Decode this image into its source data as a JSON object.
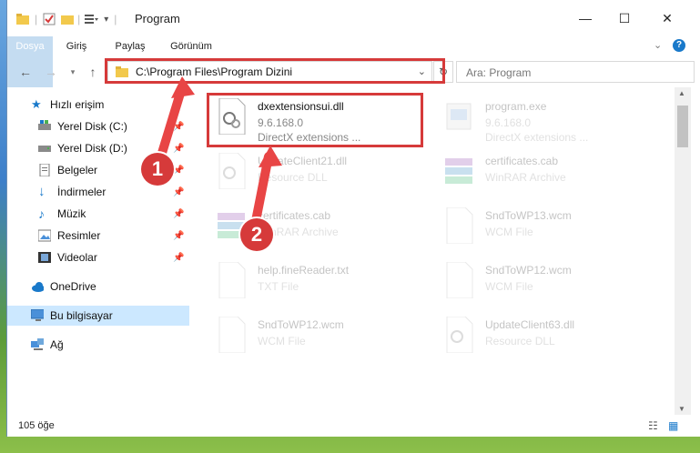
{
  "window": {
    "title": "Program"
  },
  "ribbon": {
    "tabs": [
      "Dosya",
      "Giriş",
      "Paylaş",
      "Görünüm"
    ]
  },
  "address": {
    "path": "C:\\Program Files\\Program Dizini"
  },
  "search": {
    "placeholder": "Ara: Program"
  },
  "sidebar": {
    "items": [
      {
        "label": "Hızlı erişim",
        "icon": "star-icon"
      },
      {
        "label": "Yerel Disk (C:)",
        "icon": "drive-icon"
      },
      {
        "label": "Yerel Disk (D:)",
        "icon": "drive-icon"
      },
      {
        "label": "Belgeler",
        "icon": "documents-icon"
      },
      {
        "label": "İndirmeler",
        "icon": "download-icon"
      },
      {
        "label": "Müzik",
        "icon": "music-icon"
      },
      {
        "label": "Resimler",
        "icon": "pictures-icon"
      },
      {
        "label": "Videolar",
        "icon": "videos-icon"
      },
      {
        "label": "OneDrive",
        "icon": "cloud-icon"
      },
      {
        "label": "Bu bilgisayar",
        "icon": "computer-icon"
      },
      {
        "label": "Ağ",
        "icon": "network-icon"
      }
    ]
  },
  "files": [
    {
      "name": "dxextensionsui.dll",
      "s1": "9.6.168.0",
      "s2": "DirectX extensions ..."
    },
    {
      "name": "program.exe",
      "s1": "9.6.168.0",
      "s2": "DirectX extensions ..."
    },
    {
      "name": "UpdateClient21.dll",
      "s1": "Resource DLL",
      "s2": ""
    },
    {
      "name": "certificates.cab",
      "s1": "WinRAR Archive",
      "s2": ""
    },
    {
      "name": "certificates.cab",
      "s1": "WinRAR Archive",
      "s2": ""
    },
    {
      "name": "SndToWP13.wcm",
      "s1": "WCM File",
      "s2": ""
    },
    {
      "name": "help.fineReader.txt",
      "s1": "TXT File",
      "s2": ""
    },
    {
      "name": "SndToWP12.wcm",
      "s1": "WCM File",
      "s2": ""
    },
    {
      "name": "SndToWP12.wcm",
      "s1": "WCM File",
      "s2": ""
    },
    {
      "name": "UpdateClient63.dll",
      "s1": "Resource DLL",
      "s2": ""
    }
  ],
  "status": {
    "count": "105 öğe"
  },
  "callouts": [
    "1",
    "2"
  ],
  "colors": {
    "accent": "#1979ca",
    "highlight": "#d63a3a"
  }
}
